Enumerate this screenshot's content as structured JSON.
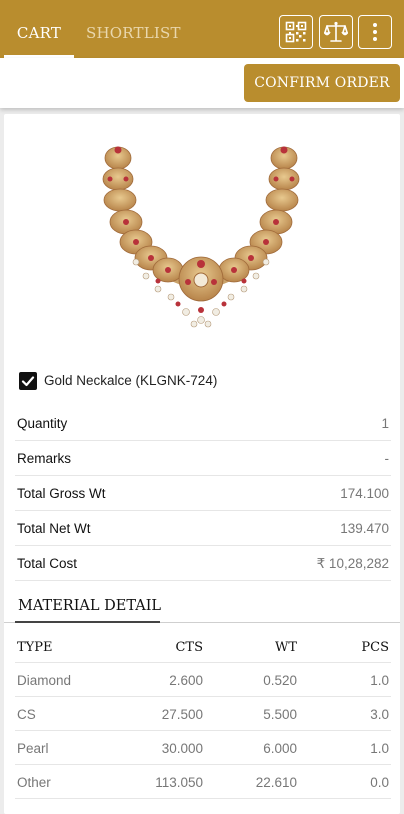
{
  "header": {
    "tabs": [
      {
        "label": "CART",
        "active": true
      },
      {
        "label": "SHORTLIST",
        "active": false
      }
    ],
    "icons": [
      "qr-code-icon",
      "scale-icon",
      "more-vertical-icon"
    ],
    "accent_color": "#b98d2e"
  },
  "toolbar": {
    "confirm_label": "CONFIRM ORDER"
  },
  "product": {
    "checked": true,
    "name": "Gold Neckalce (KLGNK-724)",
    "details": [
      {
        "label": "Quantity",
        "value": "1"
      },
      {
        "label": "Remarks",
        "value": "-"
      },
      {
        "label": "Total Gross Wt",
        "value": "174.100"
      },
      {
        "label": "Total Net Wt",
        "value": "139.470"
      },
      {
        "label": "Total Cost",
        "value": "₹ 10,28,282"
      }
    ]
  },
  "material": {
    "title": "MATERIAL DETAIL",
    "columns": [
      "TYPE",
      "CTS",
      "WT",
      "PCS"
    ],
    "rows": [
      [
        "Diamond",
        "2.600",
        "0.520",
        "1.0"
      ],
      [
        "CS",
        "27.500",
        "5.500",
        "3.0"
      ],
      [
        "Pearl",
        "30.000",
        "6.000",
        "1.0"
      ],
      [
        "Other",
        "113.050",
        "22.610",
        "0.0"
      ]
    ]
  }
}
